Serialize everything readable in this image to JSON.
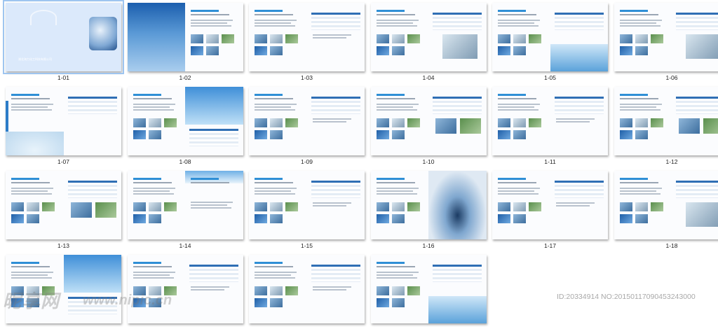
{
  "thumbnails": [
    {
      "label": "1-01",
      "style": "cover",
      "selected": true
    },
    {
      "label": "1-02",
      "style": "sea"
    },
    {
      "label": "1-03",
      "style": "text"
    },
    {
      "label": "1-04",
      "style": "lab"
    },
    {
      "label": "1-05",
      "style": "water"
    },
    {
      "label": "1-06",
      "style": "lab2"
    },
    {
      "label": "1-07",
      "style": "ripple"
    },
    {
      "label": "1-08",
      "style": "sky"
    },
    {
      "label": "1-09",
      "style": "text"
    },
    {
      "label": "1-10",
      "style": "plant"
    },
    {
      "label": "1-11",
      "style": "text"
    },
    {
      "label": "1-12",
      "style": "tank"
    },
    {
      "label": "1-13",
      "style": "drums"
    },
    {
      "label": "1-14",
      "style": "cloud"
    },
    {
      "label": "1-15",
      "style": "text"
    },
    {
      "label": "1-16",
      "style": "drop"
    },
    {
      "label": "1-17",
      "style": "text"
    },
    {
      "label": "1-18",
      "style": "lab2"
    },
    {
      "label": "",
      "style": "sky"
    },
    {
      "label": "",
      "style": "text"
    },
    {
      "label": "",
      "style": "text"
    },
    {
      "label": "",
      "style": "water"
    }
  ],
  "cover": {
    "company": "湖北海力化工科技有限公司"
  },
  "watermark": {
    "brand": "昵享网",
    "url": "www.nipic.cn",
    "id_text": "ID:20334914 NO:20150117090453243000"
  },
  "colors": {
    "accent": "#2f8fd6",
    "selection": "#9ec5f0"
  }
}
